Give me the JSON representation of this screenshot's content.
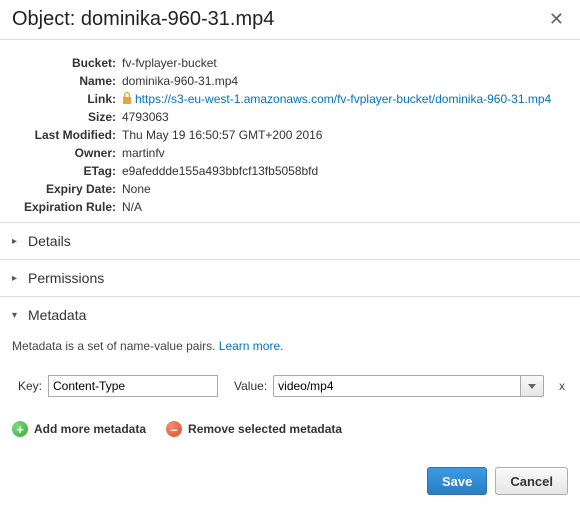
{
  "header": {
    "title_prefix": "Object: ",
    "object_name": "dominika-960-31.mp4"
  },
  "properties": {
    "bucket": {
      "label": "Bucket:",
      "value": "fv-fvplayer-bucket"
    },
    "name": {
      "label": "Name:",
      "value": "dominika-960-31.mp4"
    },
    "link": {
      "label": "Link:",
      "value": "https://s3-eu-west-1.amazonaws.com/fv-fvplayer-bucket/dominika-960-31.mp4"
    },
    "size": {
      "label": "Size:",
      "value": "4793063"
    },
    "last_modified": {
      "label": "Last Modified:",
      "value": "Thu May 19 16:50:57 GMT+200 2016"
    },
    "owner": {
      "label": "Owner:",
      "value": "martinfv"
    },
    "etag": {
      "label": "ETag:",
      "value": "e9afeddde155a493bbfcf13fb5058bfd"
    },
    "expiry": {
      "label": "Expiry Date:",
      "value": "None"
    },
    "expiration": {
      "label": "Expiration Rule:",
      "value": "N/A"
    }
  },
  "sections": {
    "details": "Details",
    "permissions": "Permissions",
    "metadata": "Metadata"
  },
  "metadata_panel": {
    "description": "Metadata is a set of name-value pairs. ",
    "learn_more": "Learn more",
    "key_label": "Key:",
    "value_label": "Value:",
    "row": {
      "key": "Content-Type",
      "value": "video/mp4"
    },
    "remove_row": "x",
    "add_action": "Add more metadata",
    "remove_action": "Remove selected metadata"
  },
  "footer": {
    "save": "Save",
    "cancel": "Cancel"
  }
}
